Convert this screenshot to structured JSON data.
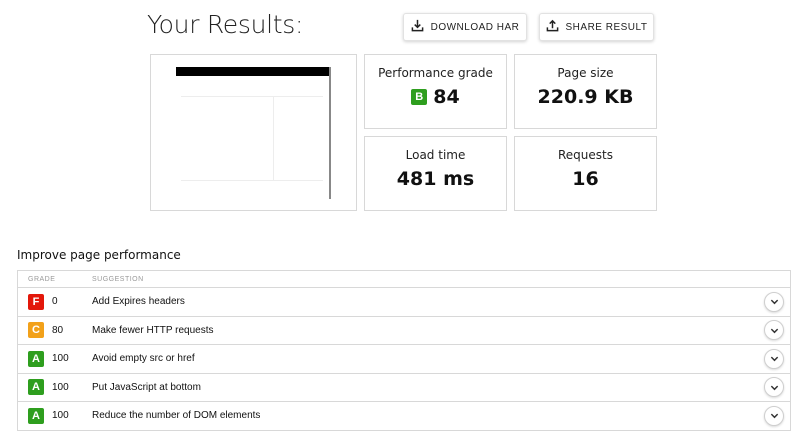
{
  "header": {
    "title": "Your Results:",
    "download_label": "DOWNLOAD HAR",
    "share_label": "SHARE RESULT"
  },
  "metrics": {
    "performance": {
      "label": "Performance grade",
      "grade": "B",
      "value": "84"
    },
    "page_size": {
      "label": "Page size",
      "value": "220.9 KB"
    },
    "load_time": {
      "label": "Load time",
      "value": "481 ms"
    },
    "requests": {
      "label": "Requests",
      "value": "16"
    }
  },
  "improve": {
    "title": "Improve page performance",
    "columns": {
      "grade": "GRADE",
      "suggestion": "SUGGESTION"
    },
    "rows": [
      {
        "grade": "F",
        "score": "0",
        "suggestion": "Add Expires headers"
      },
      {
        "grade": "C",
        "score": "80",
        "suggestion": "Make fewer HTTP requests"
      },
      {
        "grade": "A",
        "score": "100",
        "suggestion": "Avoid empty src or href"
      },
      {
        "grade": "A",
        "score": "100",
        "suggestion": "Put JavaScript at bottom"
      },
      {
        "grade": "A",
        "score": "100",
        "suggestion": "Reduce the number of DOM elements"
      }
    ]
  },
  "colors": {
    "grade_a": "#2e9e1e",
    "grade_b": "#2e9e1e",
    "grade_c": "#f2a11a",
    "grade_f": "#e3170a"
  },
  "icons": {
    "download": "download-icon",
    "share": "share-icon",
    "expand": "chevron-down-icon"
  }
}
